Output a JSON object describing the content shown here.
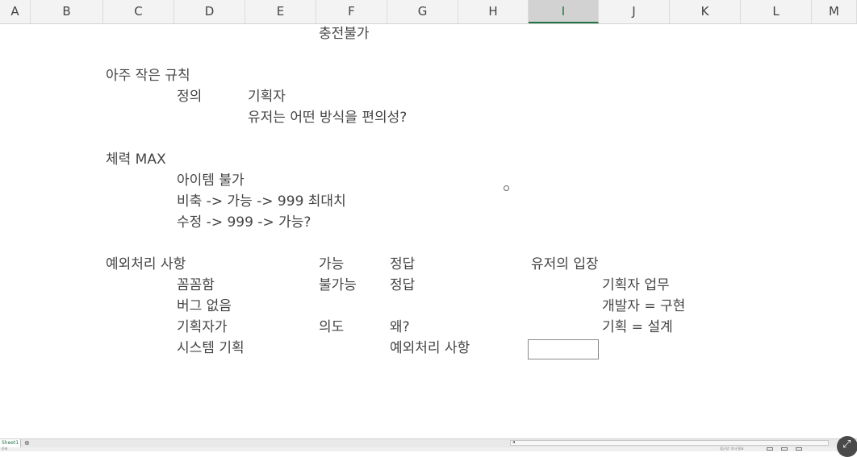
{
  "columns": [
    "A",
    "B",
    "C",
    "D",
    "E",
    "F",
    "G",
    "H",
    "I",
    "J",
    "K",
    "L",
    "M"
  ],
  "selected_column": "I",
  "cells": {
    "charge_unavailable": "충전불가",
    "tiny_rule": "아주 작은 규칙",
    "definition": "정의",
    "planner": "기획자",
    "user_question": "유저는 어떤 방식을 편의성?",
    "hp_max": "체력 MAX",
    "item_unavailable": "아이템 불가",
    "stockpile": "비축 -> 가능 -> 999 최대치",
    "modify": "수정 -> 999 -> 가능?",
    "exception_handling": "예외처리 사항",
    "possible": "가능",
    "answer1": "정답",
    "user_position": "유저의 입장",
    "thorough": "꼼꼼함",
    "impossible": "불가능",
    "answer2": "정답",
    "planner_work": "기획자 업무",
    "no_bugs": "버그 없음",
    "developer_impl": "개발자 = 구현",
    "planner_subject": "기획자가",
    "intent": "의도",
    "why": "왜?",
    "planning_design": "기획 = 설계",
    "system_planning": "시스템 기획",
    "exception_handling2": "예외처리 사항"
  },
  "sheet_tab": "Sheet1",
  "add_sheet_symbol": "⊕",
  "status_text": "준비",
  "accessibility_text": "접근성: 조사 필요",
  "zoom_symbol": "⤢"
}
